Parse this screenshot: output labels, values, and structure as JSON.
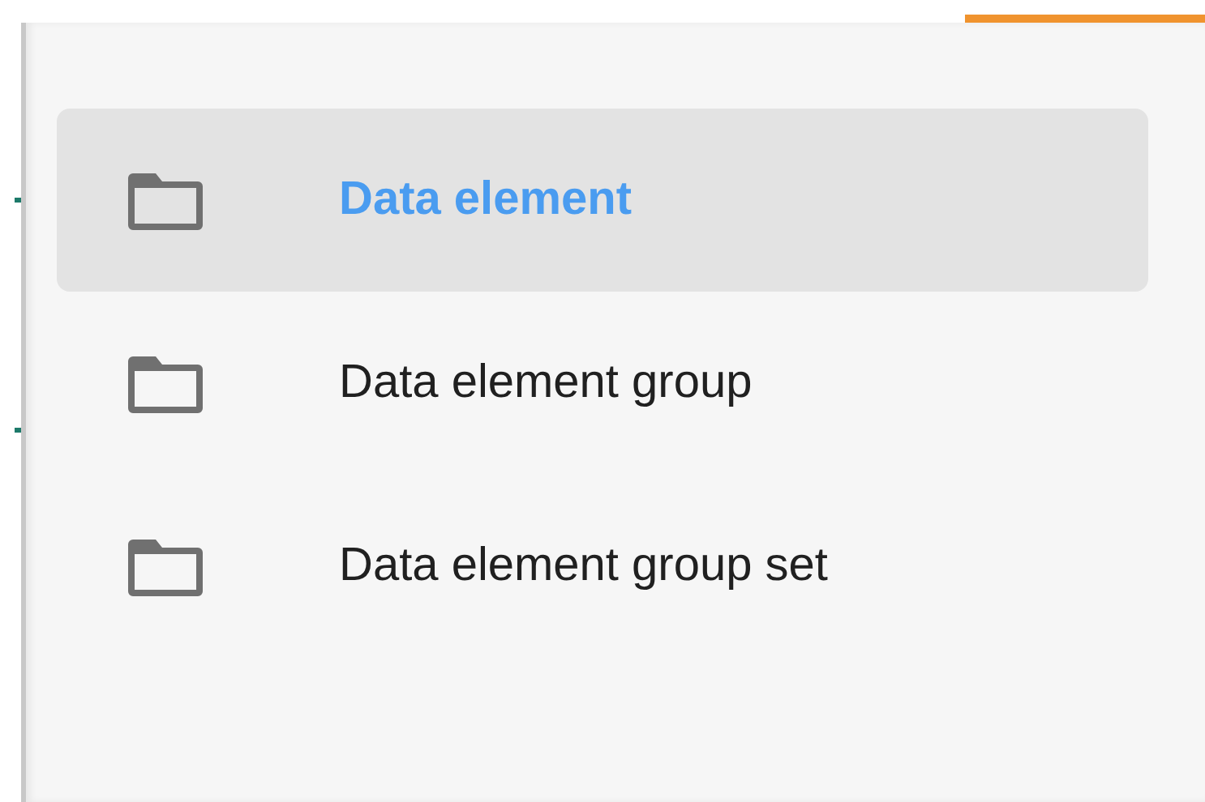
{
  "menu": {
    "items": [
      {
        "label": "Data element",
        "selected": true
      },
      {
        "label": "Data element group",
        "selected": false
      },
      {
        "label": "Data element group set",
        "selected": false
      }
    ]
  }
}
